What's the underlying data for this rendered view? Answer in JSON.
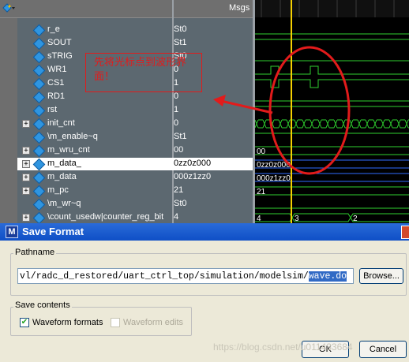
{
  "wave": {
    "msgs_label": "Msgs",
    "signals": [
      {
        "name": "r_e",
        "value": "St0",
        "expandable": false
      },
      {
        "name": "SOUT",
        "value": "St1",
        "expandable": false
      },
      {
        "name": "sTRIG",
        "value": "St0",
        "expandable": false
      },
      {
        "name": "WR1",
        "value": "0",
        "expandable": false
      },
      {
        "name": "CS1",
        "value": "1",
        "expandable": false
      },
      {
        "name": "RD1",
        "value": "0",
        "expandable": false
      },
      {
        "name": "rst",
        "value": "1",
        "expandable": false
      },
      {
        "name": "init_cnt",
        "value": "0",
        "expandable": true
      },
      {
        "name": "\\m_enable~q",
        "value": "St1",
        "expandable": false
      },
      {
        "name": "m_wru_cnt",
        "value": "00",
        "expandable": true
      },
      {
        "name": "m_data_",
        "value": "0zz0z000",
        "expandable": true,
        "selected": true
      },
      {
        "name": "m_data",
        "value": "000z1zz0",
        "expandable": true
      },
      {
        "name": "m_pc",
        "value": "21",
        "expandable": true
      },
      {
        "name": "\\m_wr~q",
        "value": "St0",
        "expandable": false
      },
      {
        "name": "\\count_usedw|counter_reg_bit",
        "value": "4",
        "expandable": true
      }
    ],
    "wave_labels": {
      "m_wru_cnt": "00",
      "m_data_": "0zz0z000",
      "m_data": "000z1zz0",
      "m_pc": "21",
      "count_a": "4",
      "count_b": "3",
      "count_c": "2"
    },
    "annotation": "先将光标点到波形界面！",
    "cursor_color": "#f5d000",
    "accent_red": "#e21b1b"
  },
  "dialog": {
    "title": "Save Format",
    "pathname_group": "Pathname",
    "path_prefix": "vl/radc_d_restored/uart_ctrl_top/simulation/modelsim/",
    "path_selected": "wave.do",
    "browse_label": "Browse...",
    "save_contents_group": "Save contents",
    "waveform_formats_label": "Waveform formats",
    "waveform_formats_checked": true,
    "waveform_edits_label": "Waveform edits",
    "waveform_edits_checked": false,
    "ok_label": "OK",
    "cancel_label": "Cancel",
    "watermark": "https://blog.csdn.net/u011433684"
  }
}
